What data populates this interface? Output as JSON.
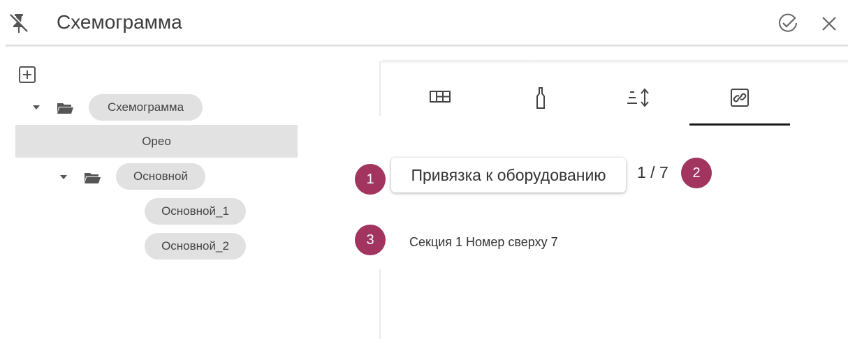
{
  "window": {
    "title": "Схемограмма",
    "pin_icon": "pin-off-icon",
    "apply_icon": "check-circle-icon",
    "close_icon": "close-icon"
  },
  "tree": {
    "add_icon": "add-box-icon",
    "nodes": [
      {
        "label": "Схемограмма",
        "type": "folder",
        "expanded": true
      },
      {
        "label": "Орео",
        "type": "item",
        "selected": true
      },
      {
        "label": "Основной",
        "type": "folder",
        "expanded": true
      },
      {
        "label": "Основной_1",
        "type": "item"
      },
      {
        "label": "Основной_2",
        "type": "item"
      }
    ]
  },
  "tabs": [
    {
      "icon": "grid-icon",
      "active": false
    },
    {
      "icon": "bottle-icon",
      "active": false
    },
    {
      "icon": "sort-height-icon",
      "active": false
    },
    {
      "icon": "link-icon",
      "active": true
    }
  ],
  "binding": {
    "button_label": "Привязка к оборудованию",
    "counter": "1 / 7",
    "section_text": "Секция 1 Номер сверху 7"
  },
  "callouts": [
    "1",
    "2",
    "3"
  ],
  "colors": {
    "callout": "#a23560",
    "selected_row": "#e2e2e2",
    "chip": "#e1e1e1",
    "active_tab_underline": "#1a1a1a"
  }
}
